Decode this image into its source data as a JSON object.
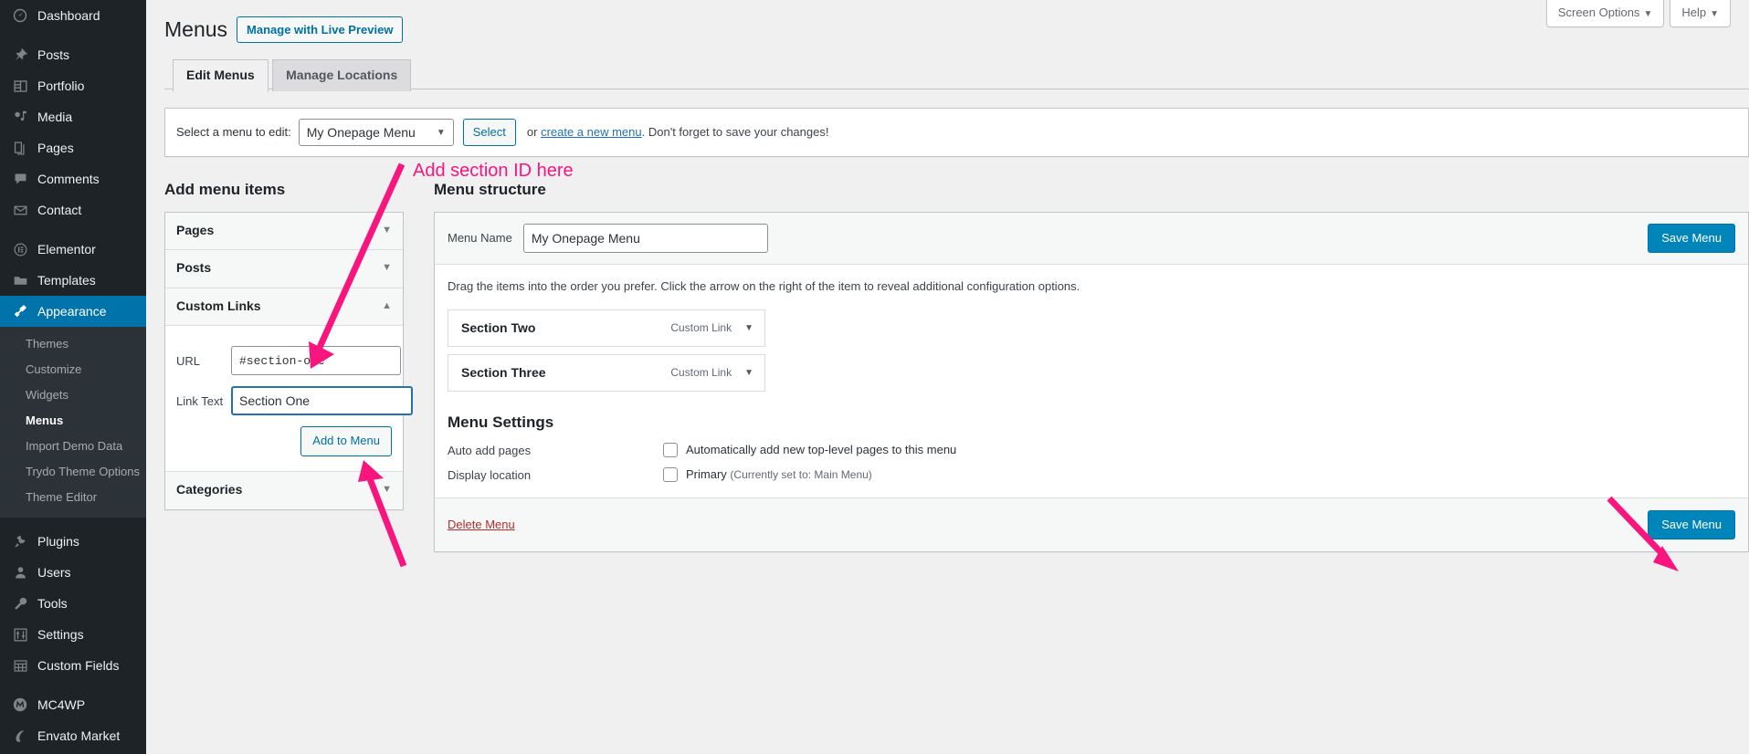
{
  "sidebar": {
    "items": [
      {
        "label": "Dashboard",
        "icon": "dashboard-icon",
        "current": false,
        "gap_after": true
      },
      {
        "label": "Posts",
        "icon": "pin-icon",
        "current": false
      },
      {
        "label": "Portfolio",
        "icon": "portfolio-icon",
        "current": false
      },
      {
        "label": "Media",
        "icon": "media-icon",
        "current": false
      },
      {
        "label": "Pages",
        "icon": "pages-icon",
        "current": false
      },
      {
        "label": "Comments",
        "icon": "comments-icon",
        "current": false
      },
      {
        "label": "Contact",
        "icon": "mail-icon",
        "current": false,
        "gap_after": true
      },
      {
        "label": "Elementor",
        "icon": "elementor-icon",
        "current": false
      },
      {
        "label": "Templates",
        "icon": "folder-icon",
        "current": false
      },
      {
        "label": "Appearance",
        "icon": "brush-icon",
        "current": true
      }
    ],
    "submenu": [
      {
        "label": "Themes",
        "current": false
      },
      {
        "label": "Customize",
        "current": false
      },
      {
        "label": "Widgets",
        "current": false
      },
      {
        "label": "Menus",
        "current": true
      },
      {
        "label": "Import Demo Data",
        "current": false
      },
      {
        "label": "Trydo Theme Options",
        "current": false
      },
      {
        "label": "Theme Editor",
        "current": false
      }
    ],
    "items_after": [
      {
        "label": "Plugins",
        "icon": "plugin-icon",
        "current": false
      },
      {
        "label": "Users",
        "icon": "users-icon",
        "current": false
      },
      {
        "label": "Tools",
        "icon": "tools-icon",
        "current": false
      },
      {
        "label": "Settings",
        "icon": "settings-icon",
        "current": false
      },
      {
        "label": "Custom Fields",
        "icon": "custom-fields-icon",
        "current": false,
        "gap_after": true
      },
      {
        "label": "MC4WP",
        "icon": "mc4wp-icon",
        "current": false
      },
      {
        "label": "Envato Market",
        "icon": "envato-icon",
        "current": false
      }
    ],
    "accent_color": "#0073aa",
    "background_color": "#1d2327"
  },
  "screen_meta": {
    "screen_options_label": "Screen Options",
    "help_label": "Help",
    "caret": "▼"
  },
  "header": {
    "title": "Menus",
    "live_preview_label": "Manage with Live Preview",
    "tabs": [
      {
        "label": "Edit Menus",
        "active": true
      },
      {
        "label": "Manage Locations",
        "active": false
      }
    ]
  },
  "select_bar": {
    "label": "Select a menu to edit:",
    "selected_menu": "My Onepage Menu",
    "options": [
      "My Onepage Menu"
    ],
    "select_button": "Select",
    "note_prefix": "or ",
    "note_link": "create a new menu",
    "note_suffix": ". Don't forget to save your changes!"
  },
  "add_menu_items": {
    "heading": "Add menu items",
    "sections": [
      {
        "label": "Pages",
        "open": false,
        "caret": "▼"
      },
      {
        "label": "Posts",
        "open": false,
        "caret": "▼"
      },
      {
        "label": "Custom Links",
        "open": true,
        "caret": "▲"
      },
      {
        "label": "Categories",
        "open": false,
        "caret": "▼"
      }
    ],
    "custom_links": {
      "url_label": "URL",
      "url_value": "#section-one",
      "url_placeholder": "https://",
      "link_text_label": "Link Text",
      "link_text_value": "Section One",
      "link_text_placeholder": "",
      "add_button": "Add to Menu"
    }
  },
  "menu_structure": {
    "heading": "Menu structure",
    "menu_name_label": "Menu Name",
    "menu_name_value": "My Onepage Menu",
    "save_menu_top": "Save Menu",
    "save_menu_bottom": "Save Menu",
    "drag_help": "Drag the items into the order you prefer. Click the arrow on the right of the item to reveal additional configuration options.",
    "items": [
      {
        "title": "Section Two",
        "type": "Custom Link",
        "caret": "▼"
      },
      {
        "title": "Section Three",
        "type": "Custom Link",
        "caret": "▼"
      }
    ],
    "settings_heading": "Menu Settings",
    "settings": [
      {
        "label": "Auto add pages",
        "checkbox_checked": false,
        "text": "Automatically add new top-level pages to this menu",
        "hint": ""
      },
      {
        "label": "Display location",
        "checkbox_checked": false,
        "text": "Primary",
        "hint": "(Currently set to: Main Menu)"
      }
    ],
    "delete_link": "Delete Menu"
  },
  "annotations": {
    "color": "#f8157e",
    "add_section_id_text": "Add section ID here"
  }
}
